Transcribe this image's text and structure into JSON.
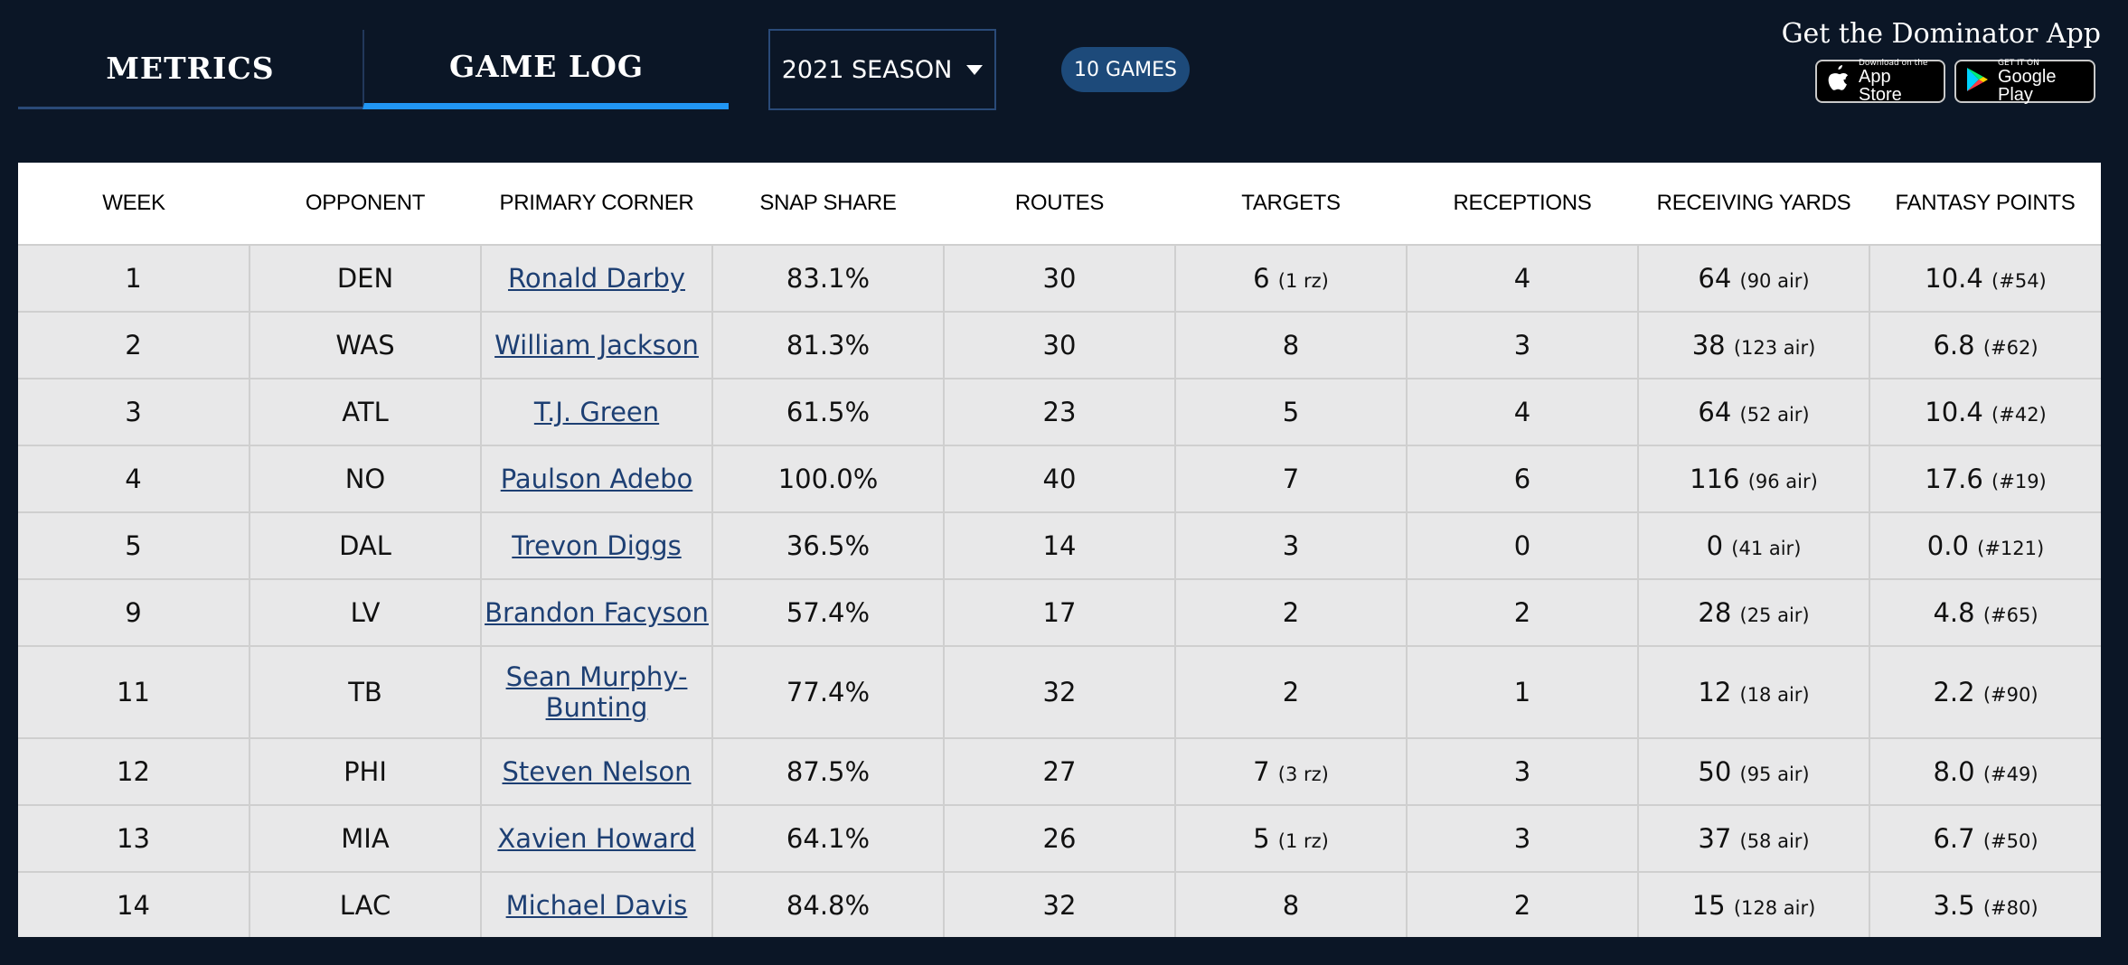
{
  "tabs": [
    {
      "label": "METRICS"
    },
    {
      "label": "GAME LOG"
    }
  ],
  "season": {
    "label": "2021 SEASON"
  },
  "games_badge": "10 GAMES",
  "app": {
    "title": "Get the Dominator App",
    "apple": {
      "small": "Download on the",
      "big": "App Store"
    },
    "google": {
      "small": "GET IT ON",
      "big": "Google Play"
    }
  },
  "table": {
    "headers": [
      "WEEK",
      "OPPONENT",
      "PRIMARY CORNER",
      "SNAP SHARE",
      "ROUTES",
      "TARGETS",
      "RECEPTIONS",
      "RECEIVING YARDS",
      "FANTASY POINTS"
    ],
    "rows": [
      {
        "week": "1",
        "opp": "DEN",
        "corner": "Ronald Darby",
        "snap": "83.1%",
        "routes": "30",
        "targets": "6",
        "targets_sub": "(1 rz)",
        "rec": "4",
        "yards": "64",
        "yards_sub": "(90 air)",
        "fp": "10.4",
        "fp_sub": "(#54)"
      },
      {
        "week": "2",
        "opp": "WAS",
        "corner": "William Jackson",
        "snap": "81.3%",
        "routes": "30",
        "targets": "8",
        "targets_sub": "",
        "rec": "3",
        "yards": "38",
        "yards_sub": "(123 air)",
        "fp": "6.8",
        "fp_sub": "(#62)"
      },
      {
        "week": "3",
        "opp": "ATL",
        "corner": "T.J. Green",
        "snap": "61.5%",
        "routes": "23",
        "targets": "5",
        "targets_sub": "",
        "rec": "4",
        "yards": "64",
        "yards_sub": "(52 air)",
        "fp": "10.4",
        "fp_sub": "(#42)"
      },
      {
        "week": "4",
        "opp": "NO",
        "corner": "Paulson Adebo",
        "snap": "100.0%",
        "routes": "40",
        "targets": "7",
        "targets_sub": "",
        "rec": "6",
        "yards": "116",
        "yards_sub": "(96 air)",
        "fp": "17.6",
        "fp_sub": "(#19)"
      },
      {
        "week": "5",
        "opp": "DAL",
        "corner": "Trevon Diggs",
        "snap": "36.5%",
        "routes": "14",
        "targets": "3",
        "targets_sub": "",
        "rec": "0",
        "yards": "0",
        "yards_sub": "(41 air)",
        "fp": "0.0",
        "fp_sub": "(#121)"
      },
      {
        "week": "9",
        "opp": "LV",
        "corner": "Brandon Facyson",
        "snap": "57.4%",
        "routes": "17",
        "targets": "2",
        "targets_sub": "",
        "rec": "2",
        "yards": "28",
        "yards_sub": "(25 air)",
        "fp": "4.8",
        "fp_sub": "(#65)"
      },
      {
        "week": "11",
        "opp": "TB",
        "corner": "Sean Murphy-Bunting",
        "snap": "77.4%",
        "routes": "32",
        "targets": "2",
        "targets_sub": "",
        "rec": "1",
        "yards": "12",
        "yards_sub": "(18 air)",
        "fp": "2.2",
        "fp_sub": "(#90)"
      },
      {
        "week": "12",
        "opp": "PHI",
        "corner": "Steven Nelson",
        "snap": "87.5%",
        "routes": "27",
        "targets": "7",
        "targets_sub": "(3 rz)",
        "rec": "3",
        "yards": "50",
        "yards_sub": "(95 air)",
        "fp": "8.0",
        "fp_sub": "(#49)"
      },
      {
        "week": "13",
        "opp": "MIA",
        "corner": "Xavien Howard",
        "snap": "64.1%",
        "routes": "26",
        "targets": "5",
        "targets_sub": "(1 rz)",
        "rec": "3",
        "yards": "37",
        "yards_sub": "(58 air)",
        "fp": "6.7",
        "fp_sub": "(#50)"
      },
      {
        "week": "14",
        "opp": "LAC",
        "corner": "Michael Davis",
        "snap": "84.8%",
        "routes": "32",
        "targets": "8",
        "targets_sub": "",
        "rec": "2",
        "yards": "15",
        "yards_sub": "(128 air)",
        "fp": "3.5",
        "fp_sub": "(#80)"
      }
    ]
  }
}
